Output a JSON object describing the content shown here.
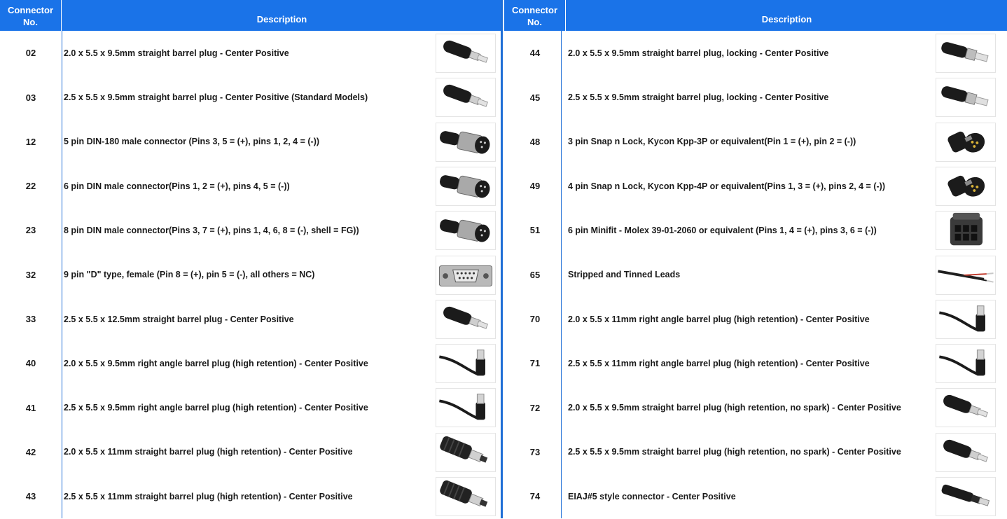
{
  "header": {
    "connector_no": "Connector No.",
    "connector_line1": "Connector",
    "connector_line2": "No.",
    "description": "Description"
  },
  "colors": {
    "header_bg": "#1a73e8",
    "header_text": "#ffffff",
    "grid_line": "#1f6fd6"
  },
  "left_rows": [
    {
      "no": "02",
      "desc": "2.0 x 5.5 x 9.5mm straight barrel plug - Center Positive",
      "icon": "barrel-plug-icon"
    },
    {
      "no": "03",
      "desc": "2.5 x 5.5 x 9.5mm straight barrel plug - Center Positive (Standard Models)",
      "icon": "barrel-plug-icon"
    },
    {
      "no": "12",
      "desc": "5 pin DIN-180 male connector (Pins 3, 5 = (+), pins 1, 2, 4 = (-))",
      "icon": "din-connector-icon"
    },
    {
      "no": "22",
      "desc": "6 pin DIN male connector(Pins 1, 2 = (+), pins 4, 5 = (-))",
      "icon": "din-connector-icon"
    },
    {
      "no": "23",
      "desc": "8 pin DIN male connector(Pins 3, 7 = (+), pins 1, 4, 6, 8 = (-), shell = FG))",
      "icon": "din-connector-icon"
    },
    {
      "no": "32",
      "desc": "9 pin \"D\" type, female (Pin 8 = (+), pin 5 = (-), all others = NC)",
      "icon": "d-sub-connector-icon"
    },
    {
      "no": "33",
      "desc": "2.5 x 5.5 x 12.5mm straight barrel plug - Center Positive",
      "icon": "barrel-plug-icon"
    },
    {
      "no": "40",
      "desc": "2.0 x 5.5 x 9.5mm right angle barrel plug (high retention) - Center Positive",
      "icon": "right-angle-plug-icon"
    },
    {
      "no": "41",
      "desc": "2.5 x 5.5 x 9.5mm right angle barrel plug (high retention) - Center Positive",
      "icon": "right-angle-plug-icon"
    },
    {
      "no": "42",
      "desc": "2.0 x 5.5 x 11mm straight barrel plug (high retention) - Center Positive",
      "icon": "ribbed-barrel-plug-icon"
    },
    {
      "no": "43",
      "desc": "2.5 x 5.5 x 11mm straight barrel plug (high retention) - Center Positive",
      "icon": "ribbed-barrel-plug-icon"
    }
  ],
  "right_rows": [
    {
      "no": "44",
      "desc": "2.0 x 5.5 x 9.5mm straight barrel plug, locking - Center Positive",
      "icon": "locking-barrel-plug-icon"
    },
    {
      "no": "45",
      "desc": "2.5 x 5.5 x 9.5mm straight barrel plug, locking - Center Positive",
      "icon": "locking-barrel-plug-icon"
    },
    {
      "no": "48",
      "desc": "3 pin Snap n Lock, Kycon Kpp-3P or equivalent(Pin 1 = (+), pin 2 = (-))",
      "icon": "snap-lock-connector-icon"
    },
    {
      "no": "49",
      "desc": "4 pin Snap n Lock, Kycon Kpp-4P or equivalent(Pins 1, 3 = (+), pins 2, 4 = (-))",
      "icon": "snap-lock-connector-icon"
    },
    {
      "no": "51",
      "desc": "6 pin Minifit - Molex 39-01-2060 or equivalent (Pins 1, 4 = (+), pins 3, 6 = (-))",
      "icon": "minifit-connector-icon"
    },
    {
      "no": "65",
      "desc": "Stripped and Tinned Leads",
      "icon": "stripped-leads-icon"
    },
    {
      "no": "70",
      "desc": "2.0 x 5.5 x 11mm right angle barrel plug (high retention) - Center Positive",
      "icon": "right-angle-plug-icon"
    },
    {
      "no": "71",
      "desc": "2.5 x 5.5 x 11mm right angle barrel plug (high retention) - Center Positive",
      "icon": "right-angle-plug-icon"
    },
    {
      "no": "72",
      "desc": "2.0 x 5.5 x 9.5mm straight barrel plug (high retention, no spark) - Center Positive",
      "icon": "barrel-plug-icon"
    },
    {
      "no": "73",
      "desc": "2.5 x 5.5 x 9.5mm straight barrel plug (high retention, no spark) - Center Positive",
      "icon": "barrel-plug-icon"
    },
    {
      "no": "74",
      "desc": "EIAJ#5 style connector - Center Positive",
      "icon": "eiaj-connector-icon"
    }
  ]
}
